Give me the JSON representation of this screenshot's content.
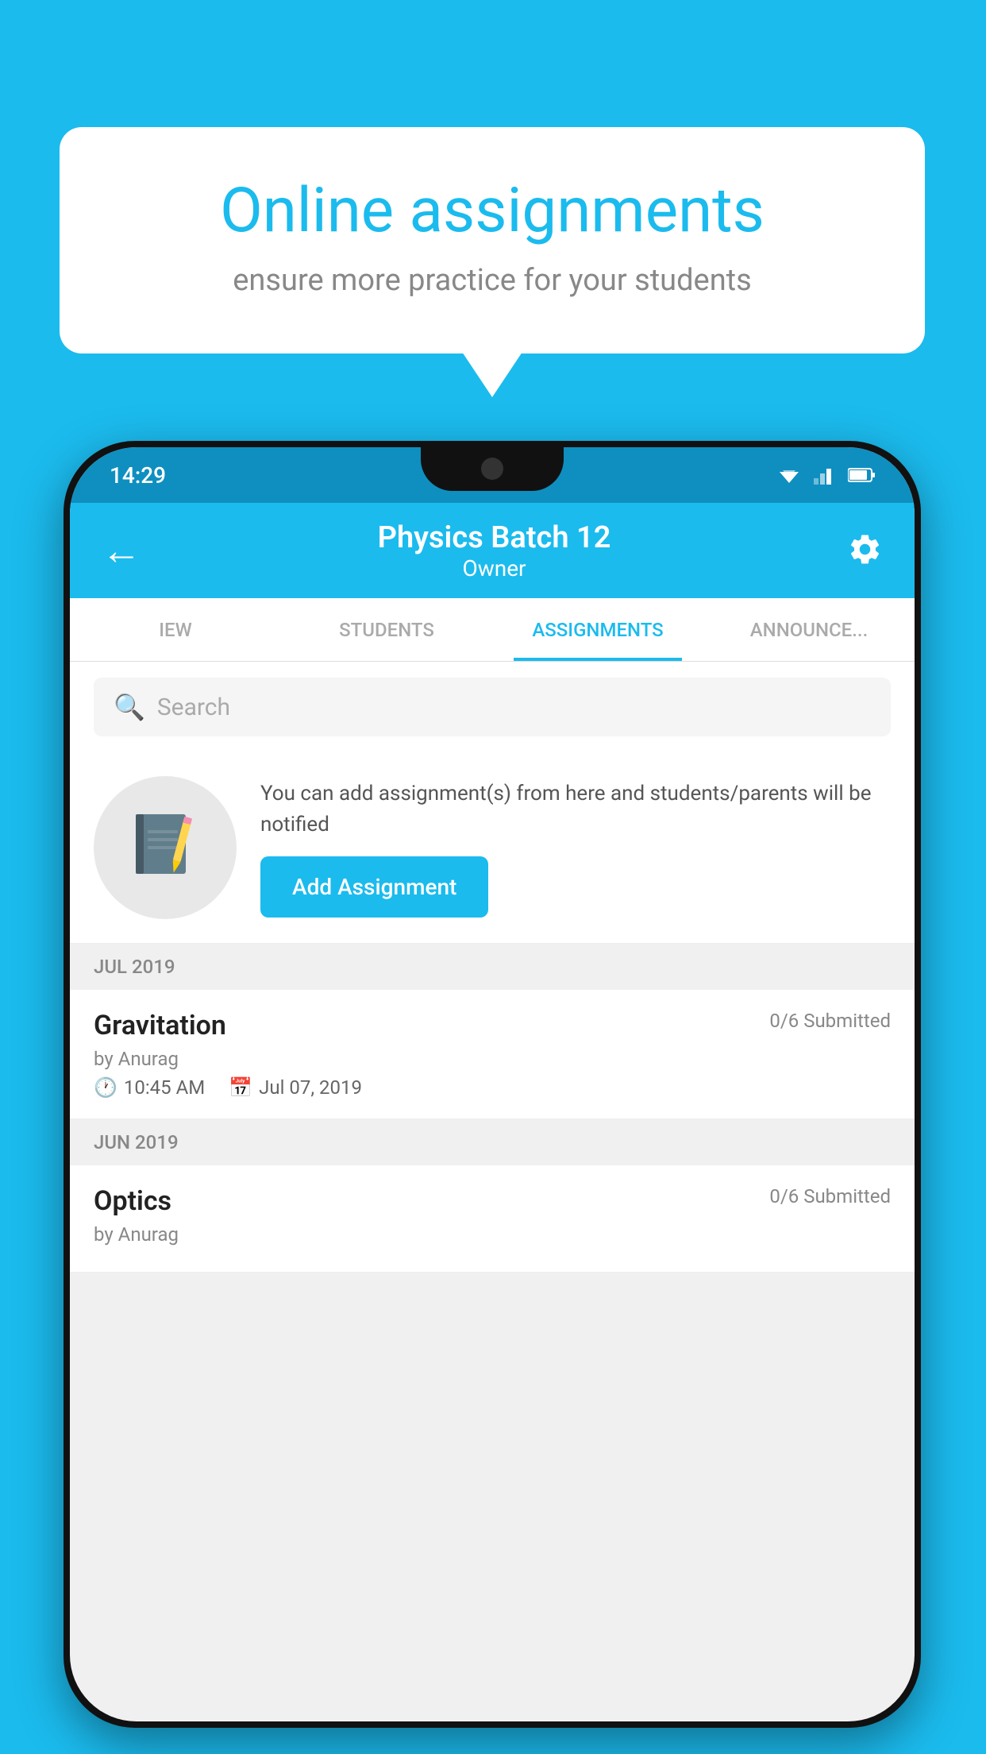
{
  "background_color": "#1BBBEE",
  "speech_bubble": {
    "title": "Online assignments",
    "subtitle": "ensure more practice for your students"
  },
  "phone": {
    "status_bar": {
      "time": "14:29"
    },
    "app_bar": {
      "title": "Physics Batch 12",
      "subtitle": "Owner",
      "back_label": "←",
      "settings_label": "⚙"
    },
    "tabs": [
      {
        "label": "IEW",
        "active": false
      },
      {
        "label": "STUDENTS",
        "active": false
      },
      {
        "label": "ASSIGNMENTS",
        "active": true
      },
      {
        "label": "ANNOUNCEMENTS",
        "active": false
      }
    ],
    "search": {
      "placeholder": "Search"
    },
    "info_box": {
      "text": "You can add assignment(s) from here and students/parents will be notified",
      "button_label": "Add Assignment"
    },
    "sections": [
      {
        "header": "JUL 2019",
        "assignments": [
          {
            "name": "Gravitation",
            "submitted": "0/6 Submitted",
            "author": "by Anurag",
            "time": "10:45 AM",
            "date": "Jul 07, 2019"
          }
        ]
      },
      {
        "header": "JUN 2019",
        "assignments": [
          {
            "name": "Optics",
            "submitted": "0/6 Submitted",
            "author": "by Anurag",
            "time": "",
            "date": ""
          }
        ]
      }
    ]
  }
}
